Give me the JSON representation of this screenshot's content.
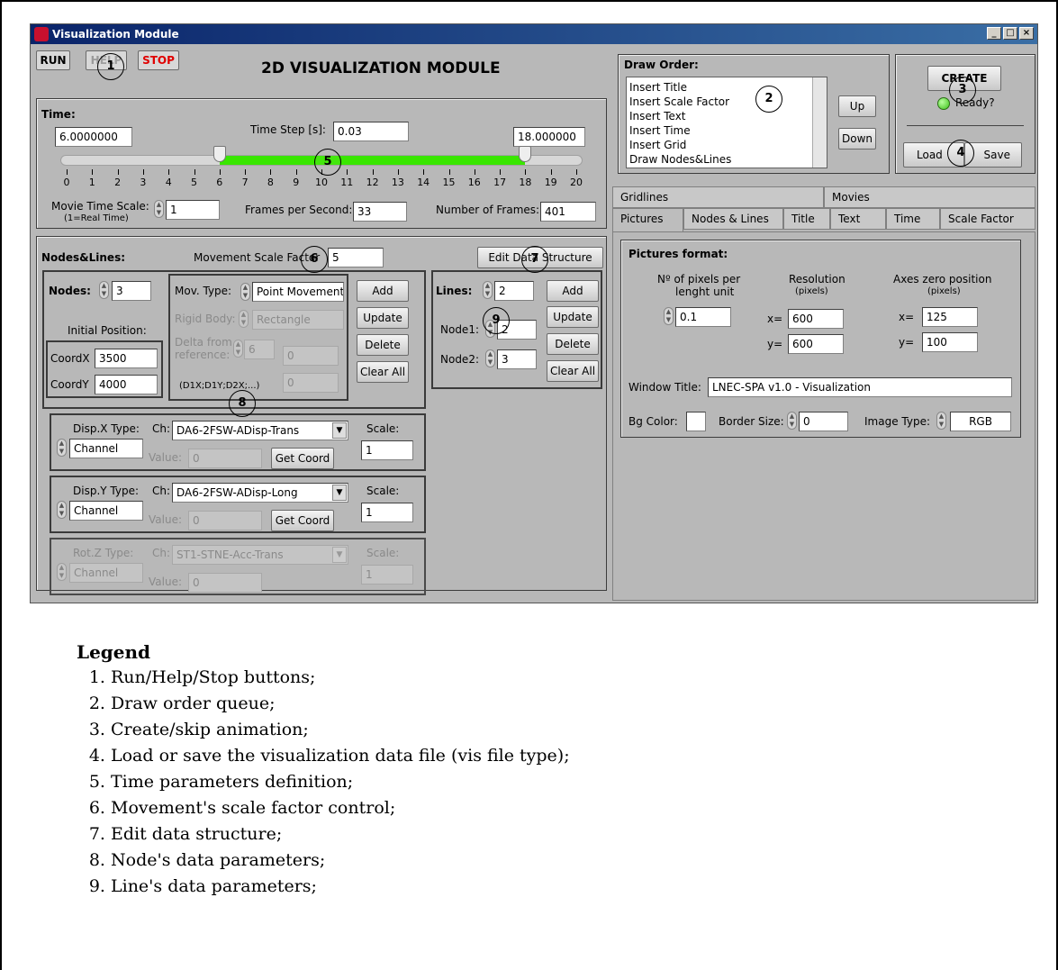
{
  "window": {
    "title": "Visualization Module",
    "heading": "2D VISUALIZATION MODULE",
    "controls": [
      "_",
      "□",
      "×"
    ]
  },
  "toolbar": {
    "run": "RUN",
    "help": "HELP",
    "stop": "STOP"
  },
  "time": {
    "section_label": "Time:",
    "start_value": "6.0000000",
    "end_value": "18.000000",
    "step_label": "Time Step [s]:",
    "step_value": "0.03",
    "ticks": [
      "0",
      "1",
      "2",
      "3",
      "4",
      "5",
      "6",
      "7",
      "8",
      "9",
      "10",
      "11",
      "12",
      "13",
      "14",
      "15",
      "16",
      "17",
      "18",
      "19",
      "20"
    ],
    "range_start": 6,
    "range_end": 18,
    "scale_max": 20,
    "range_color": "#39e600",
    "movie_scale_label": "Movie Time Scale:",
    "movie_scale_note": "(1=Real Time)",
    "movie_scale_value": "1",
    "fps_label": "Frames per Second:",
    "fps_value": "33",
    "frames_label": "Number of Frames:",
    "frames_value": "401"
  },
  "draw_order": {
    "label": "Draw Order:",
    "items": [
      "Insert Title",
      "Insert Scale Factor",
      "Insert Text",
      "Insert Time",
      "Insert Grid",
      "Draw Nodes&Lines"
    ],
    "up": "Up",
    "down": "Down"
  },
  "create": {
    "button": "CREATE",
    "ready": "Ready?",
    "led_color": "#3ec21a",
    "load": "Load",
    "save": "Save"
  },
  "nodes_lines": {
    "section_label": "Nodes&Lines:",
    "movement_scale_label": "Movement Scale Factor",
    "movement_scale_value": "5",
    "edit_button": "Edit Data Structure",
    "nodes_label": "Nodes:",
    "nodes_value": "3",
    "initial_position_label": "Initial Position:",
    "coordx_label": "CoordX",
    "coordx_value": "3500",
    "coordy_label": "CoordY",
    "coordy_value": "4000",
    "mov_type_label": "Mov. Type:",
    "mov_type_value": "Point Movement",
    "rigid_body_label": "Rigid Body:",
    "rigid_body_value": "Rectangle",
    "delta_label": "Delta from reference:",
    "delta_value": "6",
    "delta_x": "0",
    "delta_y": "0",
    "delta_note": "(D1X;D1Y;D2X;...)",
    "add": "Add",
    "update": "Update",
    "delete": "Delete",
    "clear_all": "Clear All",
    "lines_label": "Lines:",
    "lines_value": "2",
    "node1_label": "Node1:",
    "node1_value": "2",
    "node2_label": "Node2:",
    "node2_value": "3",
    "disp_x": {
      "type_label": "Disp.X Type:",
      "type_value": "Channel",
      "ch_label": "Ch:",
      "ch_value": "DA6-2FSW-ADisp-Trans",
      "value_label": "Value:",
      "value": "0",
      "get_coord": "Get Coord",
      "scale_label": "Scale:",
      "scale": "1"
    },
    "disp_y": {
      "type_label": "Disp.Y Type:",
      "type_value": "Channel",
      "ch_label": "Ch:",
      "ch_value": "DA6-2FSW-ADisp-Long",
      "value_label": "Value:",
      "value": "0",
      "get_coord": "Get Coord",
      "scale_label": "Scale:",
      "scale": "1"
    },
    "rot_z": {
      "type_label": "Rot.Z Type:",
      "type_value": "Channel",
      "ch_label": "Ch:",
      "ch_value": "ST1-STNE-Acc-Trans",
      "value_label": "Value:",
      "value": "0",
      "scale_label": "Scale:",
      "scale": "1"
    }
  },
  "tabs": {
    "row1": [
      "Gridlines",
      "Movies"
    ],
    "row2": [
      "Pictures",
      "Nodes & Lines",
      "Title",
      "Text",
      "Time",
      "Scale Factor"
    ]
  },
  "pictures": {
    "section_label": "Pictures format:",
    "pixels_label_1": "Nº of pixels per",
    "pixels_label_2": "lenght unit",
    "pixels_value": "0.1",
    "resolution_label": "Resolution",
    "resolution_unit": "(pixels)",
    "res_x": "600",
    "res_y": "600",
    "axes_label": "Axes zero position",
    "axes_unit": "(pixels)",
    "axes_x": "125",
    "axes_y": "100",
    "x_label": "x=",
    "y_label": "y=",
    "window_title_label": "Window Title:",
    "window_title_value": "LNEC-SPA v1.0 - Visualization",
    "bg_color_label": "Bg Color:",
    "border_size_label": "Border Size:",
    "border_size_value": "0",
    "image_type_label": "Image Type:",
    "image_type_value": "RGB"
  },
  "callouts": [
    "1",
    "2",
    "3",
    "4",
    "5",
    "6",
    "7",
    "8",
    "9"
  ],
  "legend": {
    "title": "Legend",
    "items": [
      "Run/Help/Stop buttons;",
      "Draw order queue;",
      "Create/skip animation;",
      "Load or save the visualization data file (vis file type);",
      "Time parameters definition;",
      "Movement's scale factor control;",
      "Edit data structure;",
      "Node's data parameters;",
      "Line's data parameters;"
    ]
  }
}
